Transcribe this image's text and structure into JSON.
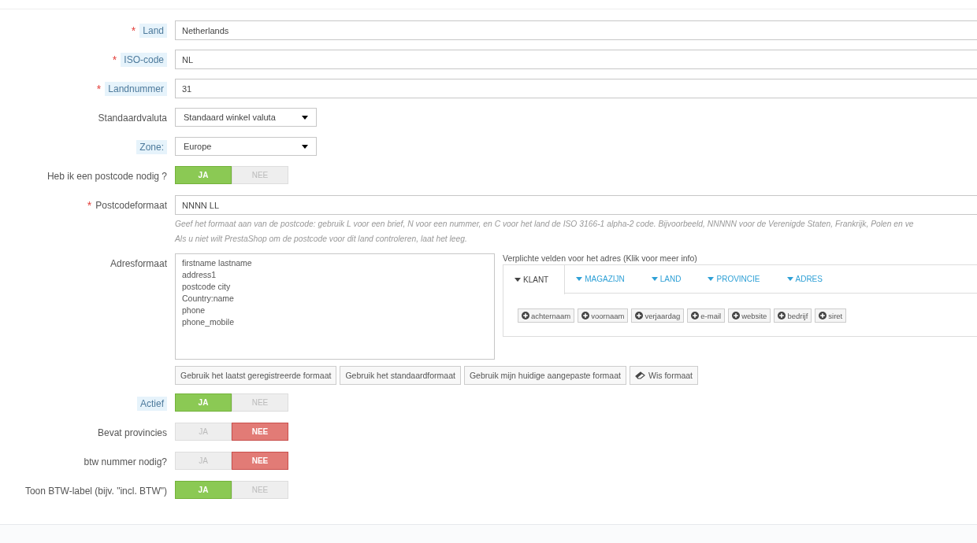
{
  "form": {
    "rows": [
      {
        "kind": "text",
        "label": "Land",
        "asterisk": "*",
        "tooltip": true,
        "value": "Netherlands"
      },
      {
        "kind": "text",
        "label": "ISO-code",
        "asterisk": "*",
        "tooltip": true,
        "value": "NL"
      },
      {
        "kind": "text",
        "label": "Landnummer",
        "asterisk": "*",
        "tooltip": true,
        "value": "31"
      },
      {
        "kind": "select",
        "label": "Standaardvaluta",
        "tooltip": false,
        "value": "Standaard winkel valuta"
      },
      {
        "kind": "select",
        "label": "Zone:",
        "tooltip": true,
        "value": "Europe"
      },
      {
        "kind": "switch",
        "label": "Heb ik een postcode nodig ?",
        "tooltip": false,
        "on": true,
        "yes": "JA",
        "no": "NEE"
      },
      {
        "kind": "text",
        "label": "Postcodeformaat",
        "asterisk": "*",
        "tooltip": false,
        "value": "NNNN LL",
        "help": [
          "Geef het formaat aan van de postcode: gebruik L voor een brief, N voor een nummer, en C voor het land de ISO 3166-1 alpha-2 code. Bijvoorbeeld, NNNNN voor de Verenigde Staten, Frankrijk, Polen en ve",
          "Als u niet wilt PrestaShop om de postcode voor dit land controleren, laat het leeg."
        ]
      },
      {
        "kind": "address",
        "label": "Adresformaat",
        "tooltip": false,
        "lines": [
          "firstname lastname",
          "address1",
          "postcode city",
          "Country:name",
          "phone",
          "phone_mobile"
        ],
        "fields_title": "Verplichte velden voor het adres (Klik voor meer info)",
        "tabs": [
          {
            "label": "KLANT",
            "selected": true
          },
          {
            "label": "MAGAZIJN",
            "selected": false
          },
          {
            "label": "LAND",
            "selected": false
          },
          {
            "label": "PROVINCIE",
            "selected": false
          },
          {
            "label": "ADRES",
            "selected": false
          }
        ],
        "field_buttons": [
          "achternaam",
          "voornaam",
          "verjaardag",
          "e-mail",
          "website",
          "bedrijf",
          "siret"
        ],
        "actions": [
          {
            "kind": "plain",
            "label": "Gebruik het laatst geregistreerde formaat"
          },
          {
            "kind": "plain",
            "label": "Gebruik het standaardformaat"
          },
          {
            "kind": "plain",
            "label": "Gebruik mijn huidige aangepaste formaat"
          },
          {
            "kind": "eraser",
            "label": "Wis formaat"
          }
        ]
      },
      {
        "kind": "switch",
        "label": "Actief",
        "tooltip": true,
        "on": true,
        "yes": "JA",
        "no": "NEE"
      },
      {
        "kind": "switch",
        "label": "Bevat provincies",
        "tooltip": false,
        "on": false,
        "yes": "JA",
        "no": "NEE"
      },
      {
        "kind": "switch",
        "label": "btw nummer nodig?",
        "tooltip": false,
        "on": false,
        "yes": "JA",
        "no": "NEE"
      },
      {
        "kind": "switch",
        "label": "Toon BTW-label (bijv. \"incl. BTW\")",
        "tooltip": false,
        "on": true,
        "yes": "JA",
        "no": "NEE"
      }
    ]
  }
}
